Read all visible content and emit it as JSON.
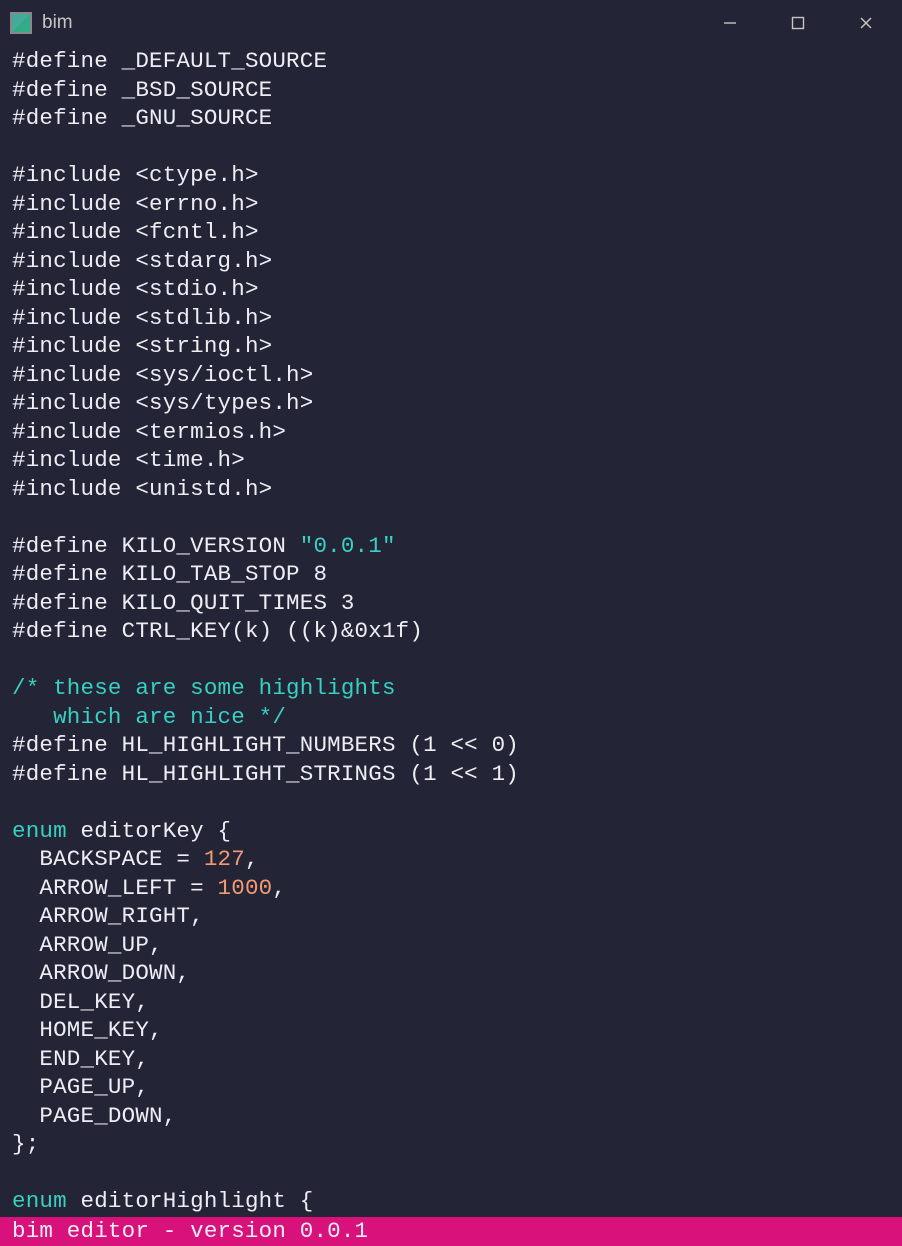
{
  "window": {
    "title": "bim"
  },
  "statusbar": {
    "text": "bim editor - version 0.0.1"
  },
  "code": {
    "lines": [
      [
        {
          "t": "#",
          "c": "c-hash"
        },
        {
          "t": "define _DEFAULT_SOURCE",
          "c": "c-text"
        }
      ],
      [
        {
          "t": "#",
          "c": "c-hash"
        },
        {
          "t": "define _BSD_SOURCE",
          "c": "c-text"
        }
      ],
      [
        {
          "t": "#",
          "c": "c-hash"
        },
        {
          "t": "define _GNU_SOURCE",
          "c": "c-text"
        }
      ],
      [],
      [
        {
          "t": "#",
          "c": "c-hash"
        },
        {
          "t": "include <ctype.h>",
          "c": "c-text"
        }
      ],
      [
        {
          "t": "#",
          "c": "c-hash"
        },
        {
          "t": "include <errno.h>",
          "c": "c-text"
        }
      ],
      [
        {
          "t": "#",
          "c": "c-hash"
        },
        {
          "t": "include <fcntl.h>",
          "c": "c-text"
        }
      ],
      [
        {
          "t": "#",
          "c": "c-hash"
        },
        {
          "t": "include <stdarg.h>",
          "c": "c-text"
        }
      ],
      [
        {
          "t": "#",
          "c": "c-hash"
        },
        {
          "t": "include <stdio.h>",
          "c": "c-text"
        }
      ],
      [
        {
          "t": "#",
          "c": "c-hash"
        },
        {
          "t": "include <stdlib.h>",
          "c": "c-text"
        }
      ],
      [
        {
          "t": "#",
          "c": "c-hash"
        },
        {
          "t": "include <string.h>",
          "c": "c-text"
        }
      ],
      [
        {
          "t": "#",
          "c": "c-hash"
        },
        {
          "t": "include <sys/ioctl.h>",
          "c": "c-text"
        }
      ],
      [
        {
          "t": "#",
          "c": "c-hash"
        },
        {
          "t": "include <sys/types.h>",
          "c": "c-text"
        }
      ],
      [
        {
          "t": "#",
          "c": "c-hash"
        },
        {
          "t": "include <termios.h>",
          "c": "c-text"
        }
      ],
      [
        {
          "t": "#",
          "c": "c-hash"
        },
        {
          "t": "include <time.h>",
          "c": "c-text"
        }
      ],
      [
        {
          "t": "#",
          "c": "c-hash"
        },
        {
          "t": "include <unistd.h>",
          "c": "c-text"
        }
      ],
      [],
      [
        {
          "t": "#",
          "c": "c-hash"
        },
        {
          "t": "define KILO_VERSION ",
          "c": "c-text"
        },
        {
          "t": "\"0.0.1\"",
          "c": "c-str"
        }
      ],
      [
        {
          "t": "#",
          "c": "c-hash"
        },
        {
          "t": "define KILO_TAB_STOP 8",
          "c": "c-text"
        }
      ],
      [
        {
          "t": "#",
          "c": "c-hash"
        },
        {
          "t": "define KILO_QUIT_TIMES 3",
          "c": "c-text"
        }
      ],
      [
        {
          "t": "#",
          "c": "c-hash"
        },
        {
          "t": "define CTRL_KEY(k) ((k)&0x1f)",
          "c": "c-text"
        }
      ],
      [],
      [
        {
          "t": "/* these are some highlights",
          "c": "c-comment"
        }
      ],
      [
        {
          "t": "   which are nice */",
          "c": "c-comment"
        }
      ],
      [
        {
          "t": "#",
          "c": "c-hash"
        },
        {
          "t": "define HL_HIGHLIGHT_NUMBERS (1 << 0)",
          "c": "c-text"
        }
      ],
      [
        {
          "t": "#",
          "c": "c-hash"
        },
        {
          "t": "define HL_HIGHLIGHT_STRINGS (1 << 1)",
          "c": "c-text"
        }
      ],
      [],
      [
        {
          "t": "enum",
          "c": "c-keyword"
        },
        {
          "t": " editorKey {",
          "c": "c-text"
        }
      ],
      [
        {
          "t": "  BACKSPACE = ",
          "c": "c-text"
        },
        {
          "t": "127",
          "c": "c-num"
        },
        {
          "t": ",",
          "c": "c-text"
        }
      ],
      [
        {
          "t": "  ARROW_LEFT = ",
          "c": "c-text"
        },
        {
          "t": "1000",
          "c": "c-num"
        },
        {
          "t": ",",
          "c": "c-text"
        }
      ],
      [
        {
          "t": "  ARROW_RIGHT,",
          "c": "c-text"
        }
      ],
      [
        {
          "t": "  ARROW_UP,",
          "c": "c-text"
        }
      ],
      [
        {
          "t": "  ARROW_DOWN,",
          "c": "c-text"
        }
      ],
      [
        {
          "t": "  DEL_KEY,",
          "c": "c-text"
        }
      ],
      [
        {
          "t": "  HOME_KEY,",
          "c": "c-text"
        }
      ],
      [
        {
          "t": "  END_KEY,",
          "c": "c-text"
        }
      ],
      [
        {
          "t": "  PAGE_UP,",
          "c": "c-text"
        }
      ],
      [
        {
          "t": "  PAGE_DOWN,",
          "c": "c-text"
        }
      ],
      [
        {
          "t": "};",
          "c": "c-text"
        }
      ],
      [],
      [
        {
          "t": "enum",
          "c": "c-keyword"
        },
        {
          "t": " editorHighlight {",
          "c": "c-text"
        }
      ]
    ]
  }
}
